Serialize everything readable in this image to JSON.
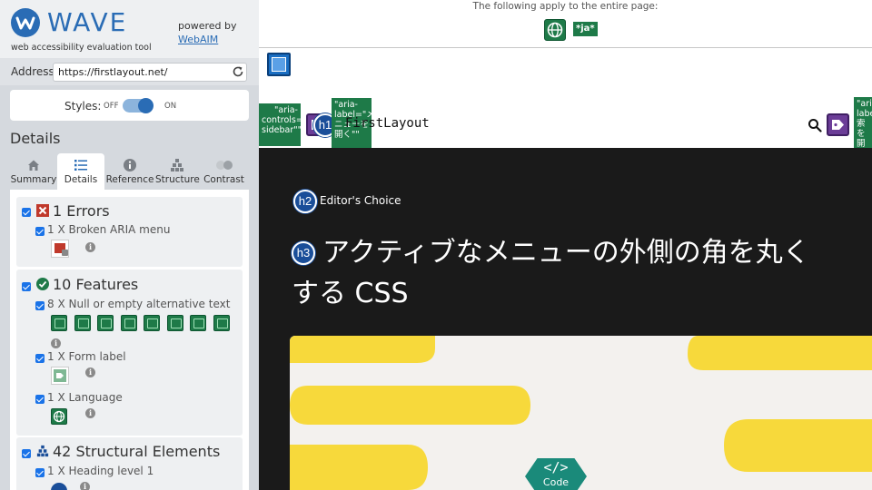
{
  "wave": {
    "logo_text": "WAVE",
    "tagline": "web accessibility evaluation tool",
    "powered_by": "powered by",
    "webaim_link": "WebAIM",
    "address_label": "Address:",
    "address_value": "https://firstlayout.net/",
    "styles_label": "Styles:",
    "styles_off": "OFF",
    "styles_on": "ON",
    "details_heading": "Details",
    "tabs": [
      {
        "label": "Summary",
        "icon": "home-icon",
        "active": false
      },
      {
        "label": "Details",
        "icon": "list-icon",
        "active": true
      },
      {
        "label": "Reference",
        "icon": "info-icon",
        "active": false
      },
      {
        "label": "Structure",
        "icon": "structure-icon",
        "active": false
      },
      {
        "label": "Contrast",
        "icon": "contrast-icon",
        "active": false
      }
    ],
    "errors": {
      "title": "1 Errors",
      "items": [
        {
          "label": "1 X Broken ARIA menu",
          "icon": "broken-aria-menu-icon",
          "count": 1
        }
      ]
    },
    "features": {
      "title": "10 Features",
      "items": [
        {
          "label": "8 X Null or empty alternative text",
          "icon": "null-alt-icon",
          "count": 8
        },
        {
          "label": "1 X Form label",
          "icon": "form-label-icon",
          "count": 1
        },
        {
          "label": "1 X Language",
          "icon": "language-icon",
          "count": 1
        }
      ]
    },
    "structure": {
      "title": "42 Structural Elements",
      "items": [
        {
          "label": "1 X Heading level 1",
          "icon": "h1-icon",
          "count": 1
        }
      ]
    }
  },
  "page": {
    "notice": "The following apply to the entire page:",
    "lang_badge": "*ja*",
    "aria_tags": [
      "\"aria-controls=\"amp-sidebar\"\"",
      "\"aria-label=\"メニューを開く\"\"",
      "\"aria-label=\"検索を開く\"\""
    ],
    "site_logo": "FirstLayout",
    "h1_badge": "h1",
    "h2_badge": "h2",
    "h3_badge": "h3",
    "kicker": "Editor's Choice",
    "title_line1": "アクティブなメニューの外側の角を丸く",
    "title_line2": "する CSS",
    "code_label": "Code"
  },
  "colors": {
    "wave_blue": "#2a6cb5",
    "feature_green": "#1e7a48",
    "error_red": "#c0392b",
    "structure_blue": "#1a4e99",
    "aria_purple": "#6b3d97",
    "hero_yellow": "#f7d93b",
    "hero_dark": "#1a1a1a"
  }
}
